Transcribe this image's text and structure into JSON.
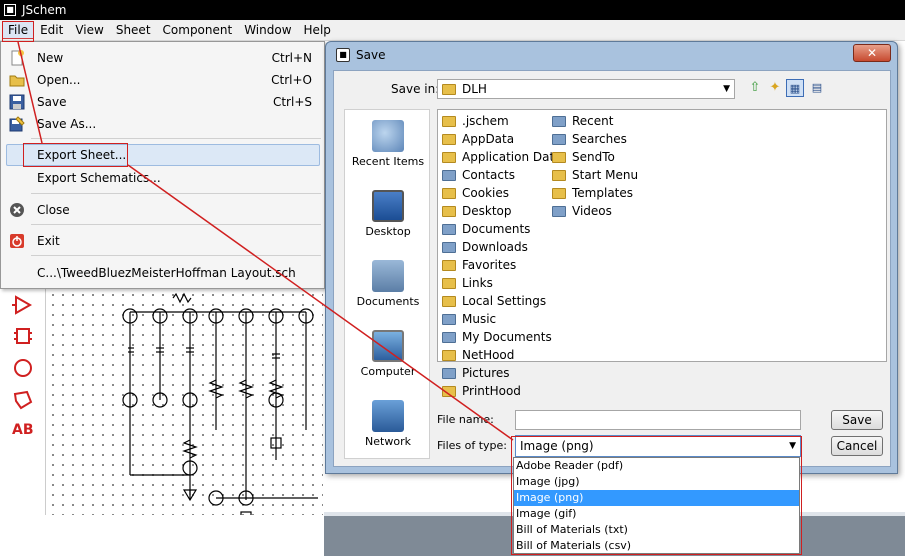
{
  "window": {
    "title": "JSchem"
  },
  "menubar": {
    "items": [
      "File",
      "Edit",
      "View",
      "Sheet",
      "Component",
      "Window",
      "Help"
    ]
  },
  "file_menu": {
    "items": [
      {
        "label": "New",
        "shortcut": "Ctrl+N",
        "icon": "new-file-icon"
      },
      {
        "label": "Open...",
        "shortcut": "Ctrl+O",
        "icon": "open-folder-icon"
      },
      {
        "label": "Save",
        "shortcut": "Ctrl+S",
        "icon": "floppy-disk-icon"
      },
      {
        "label": "Save As...",
        "shortcut": "",
        "icon": "save-as-icon"
      },
      {
        "label": "Export Sheet...",
        "shortcut": "",
        "icon": ""
      },
      {
        "label": "Export Schematics...",
        "shortcut": "",
        "icon": ""
      },
      {
        "label": "Close",
        "shortcut": "",
        "icon": "close-icon"
      },
      {
        "label": "Exit",
        "shortcut": "",
        "icon": "power-icon"
      },
      {
        "label": "C...\\TweedBluezMeisterHoffman Layout.sch",
        "shortcut": "",
        "icon": ""
      }
    ]
  },
  "left_toolbar": {
    "icons": [
      "triangle-tool-icon",
      "chip-tool-icon",
      "circle-tool-icon",
      "polygon-tool-icon"
    ],
    "text_tool": "AB"
  },
  "save_dialog": {
    "title": "Save",
    "close_label": "✕",
    "save_in_label": "Save in:",
    "save_in_value": "DLH",
    "places": [
      "Recent Items",
      "Desktop",
      "Documents",
      "Computer",
      "Network"
    ],
    "files_col1": [
      ".jschem",
      "AppData",
      "Application Data",
      "Contacts",
      "Cookies",
      "Desktop",
      "Documents",
      "Downloads",
      "Favorites",
      "Links",
      "Local Settings",
      "Music",
      "My Documents",
      "NetHood",
      "Pictures",
      "PrintHood"
    ],
    "files_col2": [
      "Recent",
      "Searches",
      "SendTo",
      "Start Menu",
      "Templates",
      "Videos"
    ],
    "file_name_label": "File name:",
    "file_name_value": "",
    "files_of_type_label": "Files of type:",
    "files_of_type_value": "Image (png)",
    "save_button": "Save",
    "cancel_button": "Cancel",
    "type_options": [
      "Adobe Reader (pdf)",
      "Image (jpg)",
      "Image (png)",
      "Image (gif)",
      "Bill of Materials (txt)",
      "Bill of Materials (csv)"
    ],
    "selected_type_index": 2
  },
  "colors": {
    "accent_red": "#d02020",
    "selection_blue": "#3399ff",
    "dialog_frame": "#a9c2de"
  }
}
